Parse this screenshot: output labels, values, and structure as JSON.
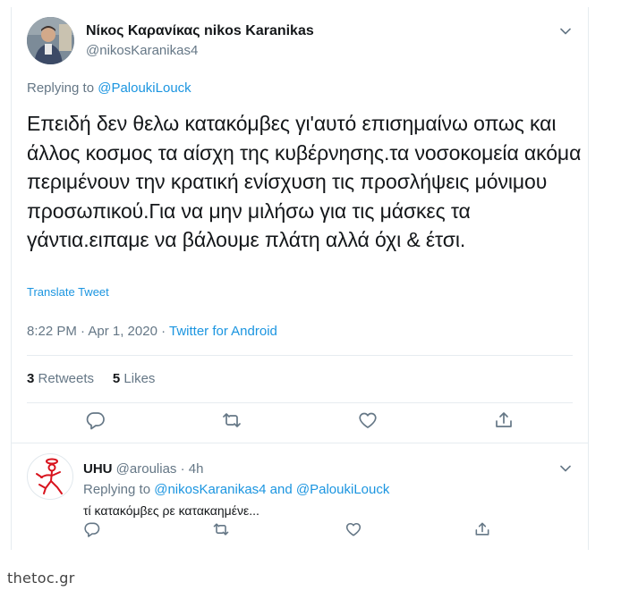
{
  "tweet": {
    "author_name": "Νίκος Καρανίκας nikos Karanikas",
    "author_handle": "@nikosKaranikas4",
    "replying_prefix": "Replying to ",
    "replying_to": "@PaloukiLouck",
    "text": "Επειδή δεν θελω κατακόμβες γι'αυτό επισημαίνω οπως και άλλος κοσμος τα αίσχη της κυβέρνησης.τα νοσοκομεία ακόμα περιμένουν την κρατική ενίσχυση τις προσλήψεις μόνιμου προσωπικού.Για να μην μιλήσω για τις μάσκες τα γάντια.ειπαμε να βάλουμε πλάτη αλλά όχι & έτσι.",
    "translate_label": "Translate Tweet",
    "time": "8:22 PM · Apr 1, 2020 · ",
    "source": "Twitter for Android",
    "retweets_count": "3",
    "retweets_label": " Retweets",
    "likes_count": "5",
    "likes_label": " Likes"
  },
  "reply": {
    "author_name": "UHU",
    "author_handle": "@aroulias",
    "age": " · 4h",
    "replying_prefix": "Replying to ",
    "replying_to_1": "@nikosKaranikas4",
    "replying_and": " and ",
    "replying_to_2": "@PaloukiLouck",
    "text": "τί κατακόμβες ρε κατακαημένε..."
  },
  "watermark": "thetoc.gr",
  "colors": {
    "link": "#1b95e0",
    "secondary_text": "#657786",
    "primary_text": "#14171a",
    "border": "#e6ecf0",
    "avatar_drawing": "#d8141e"
  },
  "icons": [
    "chevron-down-icon",
    "reply-icon",
    "retweet-icon",
    "like-icon",
    "share-icon"
  ]
}
